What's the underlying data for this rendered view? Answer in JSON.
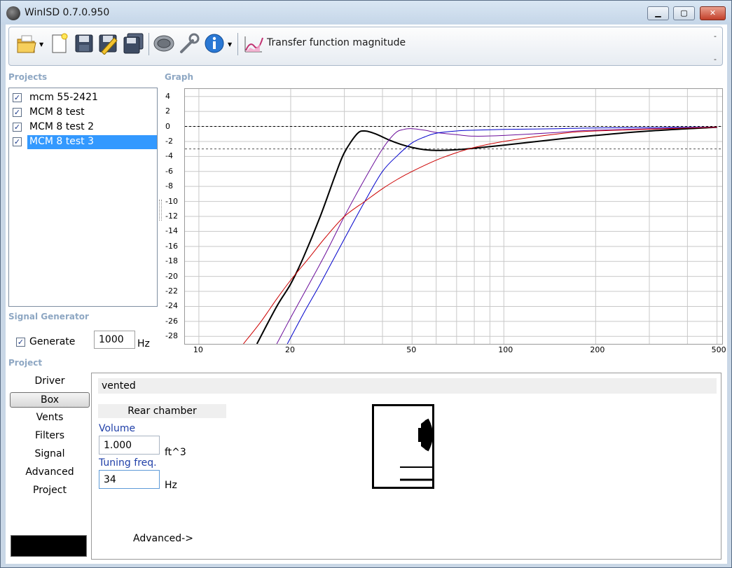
{
  "window": {
    "title": "WinISD 0.7.0.950"
  },
  "toolbar": {
    "transfer_label": "Transfer function magnitude",
    "right_dash_top": "-",
    "right_dash_bottom": "-"
  },
  "sections": {
    "projects": "Projects",
    "graph": "Graph",
    "signal_generator": "Signal Generator",
    "project": "Project"
  },
  "projects": [
    {
      "name": "mcm 55-2421",
      "checked": true,
      "selected": false
    },
    {
      "name": "MCM 8 test",
      "checked": true,
      "selected": false
    },
    {
      "name": "MCM 8 test 2",
      "checked": true,
      "selected": false
    },
    {
      "name": "MCM 8 test 3",
      "checked": true,
      "selected": true
    }
  ],
  "chart_data": {
    "type": "line",
    "title": "",
    "xlabel": "",
    "ylabel": "",
    "x_scale": "log",
    "xlim": [
      9,
      520
    ],
    "ylim": [
      -29,
      5
    ],
    "x_tick_labels": [
      10,
      20,
      50,
      100,
      200,
      500
    ],
    "y_tick_labels": [
      4,
      2,
      0,
      -2,
      -4,
      -6,
      -8,
      -10,
      -12,
      -14,
      -16,
      -18,
      -20,
      -22,
      -24,
      -26,
      -28
    ],
    "grid": true,
    "reference_lines_db": [
      0,
      -3
    ],
    "series": [
      {
        "color": "#000000",
        "width": 2,
        "x": [
          15.5,
          18,
          20,
          22,
          25,
          28,
          30,
          33,
          35,
          38,
          42,
          46,
          50,
          55,
          60,
          70,
          80,
          100,
          150,
          200,
          300,
          500
        ],
        "y": [
          -29,
          -24,
          -21,
          -17.5,
          -12,
          -6.5,
          -3.5,
          -1,
          -0.6,
          -1,
          -1.8,
          -2.4,
          -2.8,
          -3.1,
          -3.2,
          -3.1,
          -2.9,
          -2.5,
          -1.7,
          -1.2,
          -0.6,
          -0.1
        ]
      },
      {
        "color": "#6a0d9a",
        "width": 1,
        "x": [
          18,
          20,
          23,
          26,
          30,
          35,
          40,
          44,
          47,
          50,
          55,
          60,
          70,
          80,
          100,
          150,
          200,
          500
        ],
        "y": [
          -29,
          -25.5,
          -21,
          -17,
          -12,
          -7,
          -3,
          -0.9,
          -0.4,
          -0.3,
          -0.5,
          -0.8,
          -1.1,
          -1.3,
          -1.2,
          -0.8,
          -0.5,
          -0.1
        ]
      },
      {
        "color": "#0000cc",
        "width": 1,
        "x": [
          19.5,
          22,
          25,
          30,
          35,
          40,
          45,
          50,
          55,
          60,
          70,
          80,
          100,
          150,
          200,
          500
        ],
        "y": [
          -29,
          -25,
          -21,
          -15,
          -10,
          -6,
          -3.8,
          -2.2,
          -1.4,
          -0.9,
          -0.6,
          -0.5,
          -0.4,
          -0.3,
          -0.2,
          -0.1
        ]
      },
      {
        "color": "#cc0000",
        "width": 1,
        "x": [
          14,
          16,
          18,
          20,
          23,
          26,
          30,
          35,
          40,
          45,
          50,
          60,
          70,
          80,
          100,
          150,
          200,
          500
        ],
        "y": [
          -29,
          -26,
          -23,
          -20.5,
          -17.5,
          -14.8,
          -12,
          -10,
          -8.3,
          -7,
          -6,
          -4.5,
          -3.5,
          -2.8,
          -2,
          -1,
          -0.6,
          -0.1
        ]
      }
    ]
  },
  "signal_generator": {
    "generate_label": "Generate",
    "generate_checked": true,
    "frequency": "1000",
    "unit": "Hz"
  },
  "project_nav": [
    "Driver",
    "Box",
    "Vents",
    "Filters",
    "Signal",
    "Advanced",
    "Project"
  ],
  "project_nav_active": "Box",
  "box_panel": {
    "box_type": "vented",
    "rear_chamber": "Rear chamber",
    "volume_label": "Volume",
    "volume_value": "1.000",
    "volume_unit": "ft^3",
    "tuning_label": "Tuning freq.",
    "tuning_value": "34",
    "tuning_unit": "Hz",
    "advanced_link": "Advanced->"
  },
  "icons": [
    "open-folder-icon",
    "new-project-icon",
    "save-icon",
    "save-as-icon",
    "save-all-icon",
    "driver-icon",
    "tools-icon",
    "info-icon",
    "transfer-function-icon"
  ],
  "colors": {
    "selection": "#3399ff",
    "section_header": "#8ea7c3",
    "field_label": "#1f3fa8"
  }
}
